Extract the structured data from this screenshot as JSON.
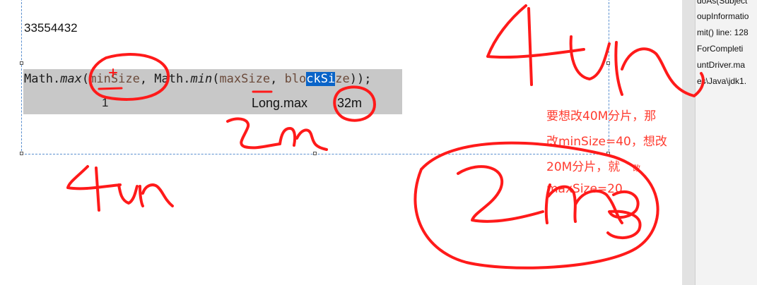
{
  "output": {
    "value": "33554432"
  },
  "code": {
    "prefix": "Math.",
    "max_fn": "max",
    "open": "(",
    "arg1": "minSize",
    "mid": ", Math.",
    "min_fn": "min",
    "open2": "(",
    "arg2": "maxSize",
    "sep": ", ",
    "arg3_a": "blo",
    "arg3_hl": "ckSi",
    "arg3_b": "ze",
    "close": "));"
  },
  "below_code": {
    "one": "1",
    "longmax": "Long.max",
    "m32": "32m"
  },
  "side_panel": {
    "lines": [
      "doAs(Subject",
      "oupInformatio",
      "mit() line: 128",
      "ForCompleti",
      "untDriver.ma",
      "es\\Java\\jdk1."
    ]
  },
  "annotation_cn": {
    "line1": "要想改40M分片，那",
    "line2": "改minSize=40，想改",
    "line3": "20M分片，就",
    "line3_small": "改",
    "line4": "maxSize=20"
  },
  "colors": {
    "ink": "#ff1a1a",
    "selection": "#0a64c8",
    "code_bg": "#c8c8c8"
  }
}
